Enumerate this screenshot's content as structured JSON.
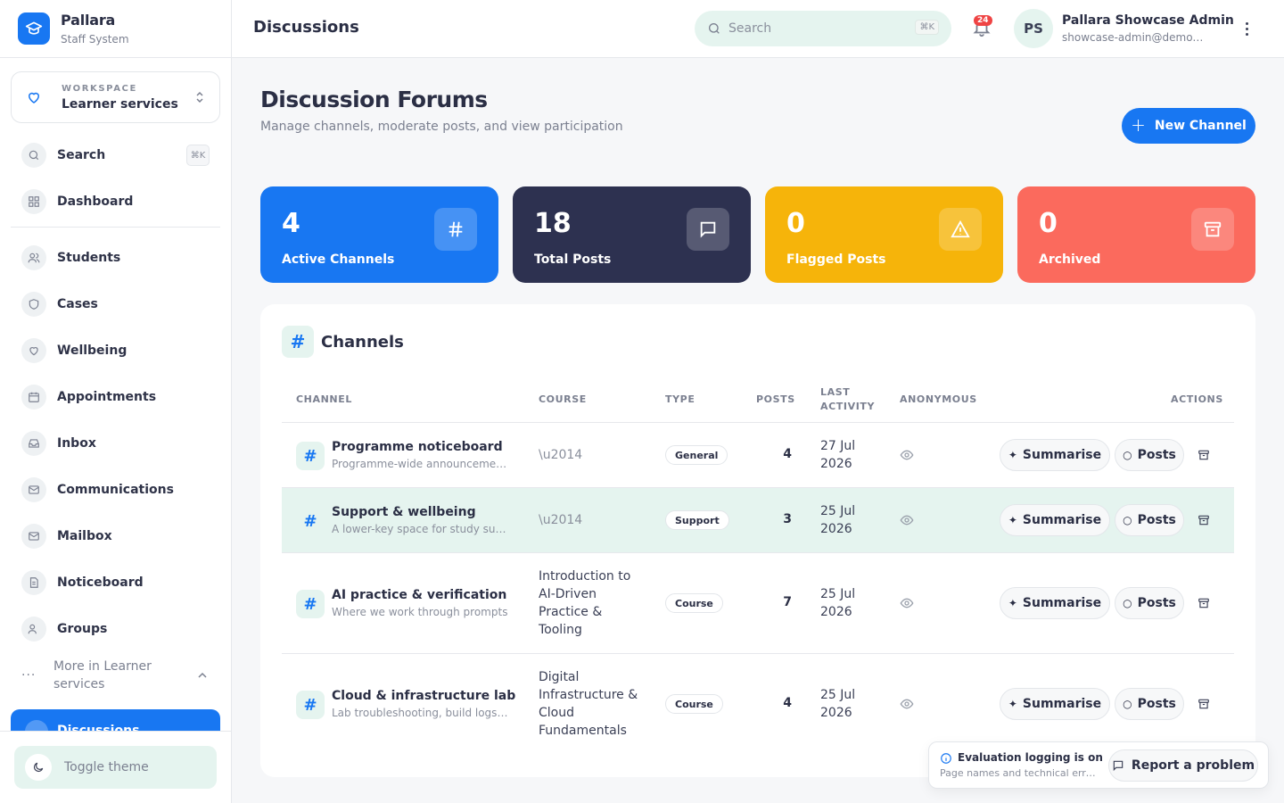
{
  "brand": {
    "name": "Pallara",
    "subtitle": "Staff System"
  },
  "workspace": {
    "label": "WORKSPACE",
    "value": "Learner services"
  },
  "sidebar": {
    "search": {
      "label": "Search",
      "shortcut": "⌘K"
    },
    "items": [
      {
        "label": "Dashboard",
        "icon": "grid-icon"
      },
      {
        "label": "Students",
        "icon": "users-icon"
      },
      {
        "label": "Cases",
        "icon": "shield-icon"
      },
      {
        "label": "Wellbeing",
        "icon": "heart-icon"
      },
      {
        "label": "Appointments",
        "icon": "calendar-icon"
      },
      {
        "label": "Inbox",
        "icon": "inbox-icon"
      },
      {
        "label": "Communications",
        "icon": "mail-icon"
      },
      {
        "label": "Mailbox",
        "icon": "mail-icon"
      },
      {
        "label": "Noticeboard",
        "icon": "document-icon"
      },
      {
        "label": "Groups",
        "icon": "users-icon"
      }
    ],
    "more": "More in Learner services",
    "active": "Discussions",
    "theme": "Toggle theme"
  },
  "topbar": {
    "title": "Discussions",
    "search_placeholder": "Search",
    "search_shortcut": "⌘K",
    "notifications": "24",
    "avatar_initials": "PS",
    "user_name": "Pallara Showcase Admin",
    "user_email": "showcase-admin@demo.pallara.edu"
  },
  "header": {
    "title": "Discussion Forums",
    "subtitle": "Manage channels, moderate posts, and view participation",
    "new_channel": "New Channel"
  },
  "stats": [
    {
      "value": "4",
      "label": "Active Channels",
      "color": "#1877f2",
      "icon": "hash-icon"
    },
    {
      "value": "18",
      "label": "Total Posts",
      "color": "#2d3150",
      "icon": "message-icon"
    },
    {
      "value": "0",
      "label": "Flagged Posts",
      "color": "#f6b40a",
      "icon": "alert-icon"
    },
    {
      "value": "0",
      "label": "Archived",
      "color": "#fb6a5d",
      "icon": "archive-icon"
    }
  ],
  "channels": {
    "title": "Channels",
    "columns": {
      "channel": "CHANNEL",
      "course": "COURSE",
      "type": "TYPE",
      "posts": "POSTS",
      "last_line1": "LAST",
      "last_line2": "ACTIVITY",
      "anonymous": "ANONYMOUS",
      "actions": "ACTIONS"
    },
    "rows": [
      {
        "name": "Programme noticeboard",
        "desc": "Programme-wide announcements and notices",
        "course": "\\u2014",
        "type": "General",
        "posts": "4",
        "last_line1": "27 Jul",
        "last_line2": "2026"
      },
      {
        "name": "Support & wellbeing",
        "desc": "A lower-key space for study support",
        "course": "\\u2014",
        "type": "Support",
        "posts": "3",
        "last_line1": "25 Jul",
        "last_line2": "2026"
      },
      {
        "name": "AI practice & verification",
        "desc": "Where we work through prompts",
        "course": "Introduction to AI-Driven Practice & Tooling",
        "type": "Course",
        "posts": "7",
        "last_line1": "25 Jul",
        "last_line2": "2026"
      },
      {
        "name": "Cloud & infrastructure lab",
        "desc": "Lab troubleshooting, build logs and",
        "course": "Digital Infrastructure & Cloud Fundamentals",
        "type": "Course",
        "posts": "4",
        "last_line1": "25 Jul",
        "last_line2": "2026"
      }
    ],
    "summarise_label": "Summarise",
    "posts_label": "Posts"
  },
  "toast": {
    "title": "Evaluation logging is on",
    "subtitle": "Page names and technical errors are logged",
    "report": "Report a problem"
  }
}
